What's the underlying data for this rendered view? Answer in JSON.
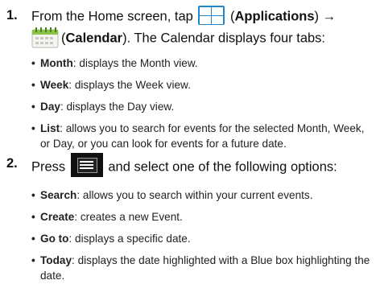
{
  "step1": {
    "number": "1.",
    "before_apps": "From the Home screen, tap",
    "apps_open": "(",
    "apps_label": "Applications",
    "apps_close_arrow": ") →",
    "cal_open": "(",
    "cal_label": "Calendar",
    "cal_rest": "). The Calendar displays four tabs:",
    "apps_icon": "applications-grid-icon",
    "cal_icon": "calendar-icon",
    "bullets": [
      {
        "term": "Month",
        "text": ": displays the Month view."
      },
      {
        "term": "Week",
        "text": ": displays the Week view."
      },
      {
        "term": "Day",
        "text": ": displays the Day view."
      },
      {
        "term": "List",
        "text": ": allows you to search for events for the selected Month, Week, or Day, or you can look for events for a future date."
      }
    ]
  },
  "step2": {
    "number": "2.",
    "before_menu": "Press",
    "after_menu": "and select one of the following options:",
    "menu_icon": "menu-key-icon",
    "bullets": [
      {
        "term": "Search",
        "text": ": allows you to search within your current events."
      },
      {
        "term": "Create",
        "text": ": creates a new Event."
      },
      {
        "term": "Go to",
        "text": ": displays a specific date."
      },
      {
        "term": "Today",
        "text": ": displays the date highlighted with a Blue box highlighting the date."
      }
    ]
  },
  "bullet_char": "•",
  "colors": {
    "apps_icon_blue": "#1e88c8",
    "text": "#1a1a1a"
  }
}
